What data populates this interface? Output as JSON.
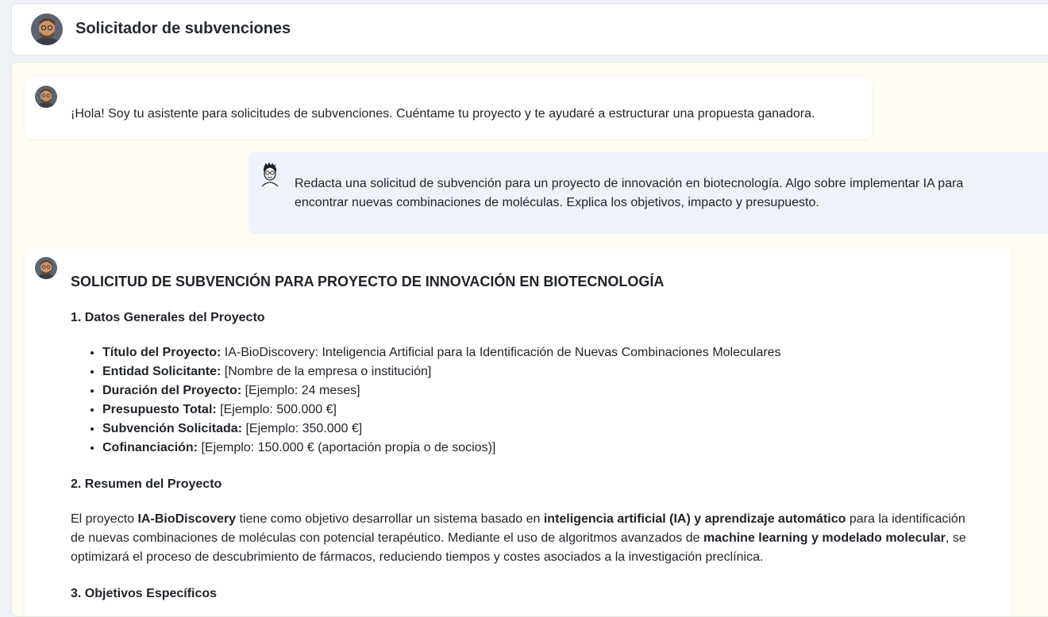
{
  "header": {
    "title": "Solicitador de subvenciones"
  },
  "messages": {
    "greeting": "¡Hola! Soy tu asistente para solicitudes de subvenciones. Cuéntame tu proyecto y te ayudaré a estructurar una propuesta ganadora.",
    "user": "Redacta una solicitud de subvención para un proyecto de innovación en biotecnología. Algo sobre implementar IA para encontrar nuevas combinaciones de moléculas. Explica los objetivos, impacto y presupuesto."
  },
  "response": {
    "title": "SOLICITUD DE SUBVENCIÓN PARA PROYECTO DE INNOVACIÓN EN BIOTECNOLOGÍA",
    "section1": "1. Datos Generales del Proyecto",
    "items": [
      {
        "label": "Título del Proyecto:",
        "value": " IA-BioDiscovery: Inteligencia Artificial para la Identificación de Nuevas Combinaciones Moleculares"
      },
      {
        "label": "Entidad Solicitante:",
        "value": " [Nombre de la empresa o institución]"
      },
      {
        "label": "Duración del Proyecto:",
        "value": " [Ejemplo: 24 meses]"
      },
      {
        "label": "Presupuesto Total:",
        "value": " [Ejemplo: 500.000 €]"
      },
      {
        "label": "Subvención Solicitada:",
        "value": " [Ejemplo: 350.000 €]"
      },
      {
        "label": "Cofinanciación:",
        "value": " [Ejemplo: 150.000 € (aportación propia o de socios)]"
      }
    ],
    "section2": "2. Resumen del Proyecto",
    "summary": {
      "t1": "El proyecto ",
      "b1": "IA-BioDiscovery",
      "t2": " tiene como objetivo desarrollar un sistema basado en ",
      "b2": "inteligencia artificial (IA) y aprendizaje automático",
      "t3": " para la identificación de nuevas combinaciones de moléculas con potencial terapéutico. Mediante el uso de algoritmos avanzados de ",
      "b3": "machine learning y modelado molecular",
      "t4": ", se optimizará el proceso de descubrimiento de fármacos, reduciendo tiempos y costes asociados a la investigación preclínica."
    },
    "section3": "3. Objetivos Específicos"
  }
}
